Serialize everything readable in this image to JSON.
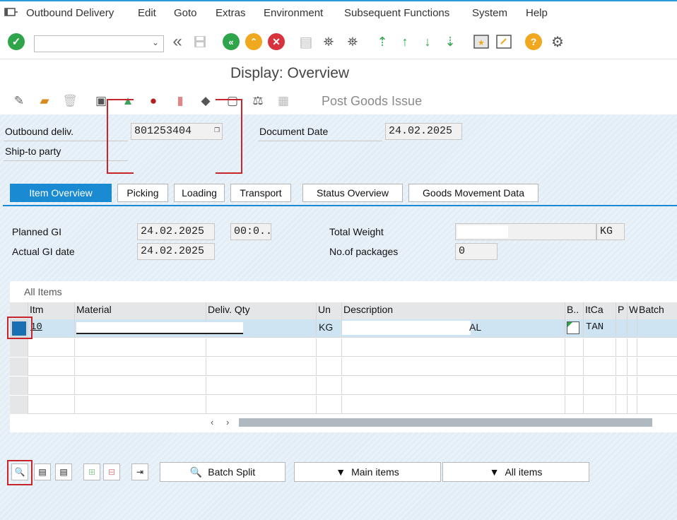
{
  "menu": {
    "items": [
      {
        "label": "Outbound Delivery",
        "u": "O"
      },
      {
        "label": "Edit",
        "u": "E"
      },
      {
        "label": "Goto",
        "u": "G"
      },
      {
        "label": "Extras",
        "u": "r"
      },
      {
        "label": "Environment",
        "u": "v"
      },
      {
        "label": "Subsequent Functions",
        "u": "F"
      },
      {
        "label": "System",
        "u": "y"
      },
      {
        "label": "Help",
        "u": "H"
      }
    ]
  },
  "title": "Display: Overview",
  "app_toolbar": {
    "post_goods_issue": "Post Goods Issue"
  },
  "header": {
    "outbound_delivery_label": "Outbound deliv.",
    "outbound_delivery_value": "801253404",
    "document_date_label": "Document Date",
    "document_date_value": "24.02.2025",
    "ship_to_label": "Ship-to party"
  },
  "tabs": [
    "Item Overview",
    "Picking",
    "Loading",
    "Transport",
    "Status Overview",
    "Goods Movement Data"
  ],
  "overview": {
    "planned_gi_label": "Planned GI",
    "planned_gi_value": "24.02.2025",
    "planned_gi_time": "00:0...",
    "actual_gi_label": "Actual GI date",
    "actual_gi_value": "24.02.2025",
    "total_weight_label": "Total Weight",
    "weight_unit": "KG",
    "packages_label": "No.of packages",
    "packages_value": "0"
  },
  "table": {
    "title": "All Items",
    "columns": [
      "Itm",
      "Material",
      "Deliv. Qty",
      "Un",
      "Description",
      "B..",
      "ItCa",
      "P",
      "W",
      "Batch"
    ],
    "rows": [
      {
        "itm": "10",
        "un": "KG",
        "desc_suffix": "AL",
        "itca": "TAN"
      }
    ]
  },
  "bottom": {
    "batch_split": "Batch Split",
    "main_items": "Main items",
    "all_items": "All items"
  },
  "colors": {
    "accent": "#1a8bd3",
    "highlight_red": "#c8242b",
    "row_selected": "#cfe4f3"
  }
}
